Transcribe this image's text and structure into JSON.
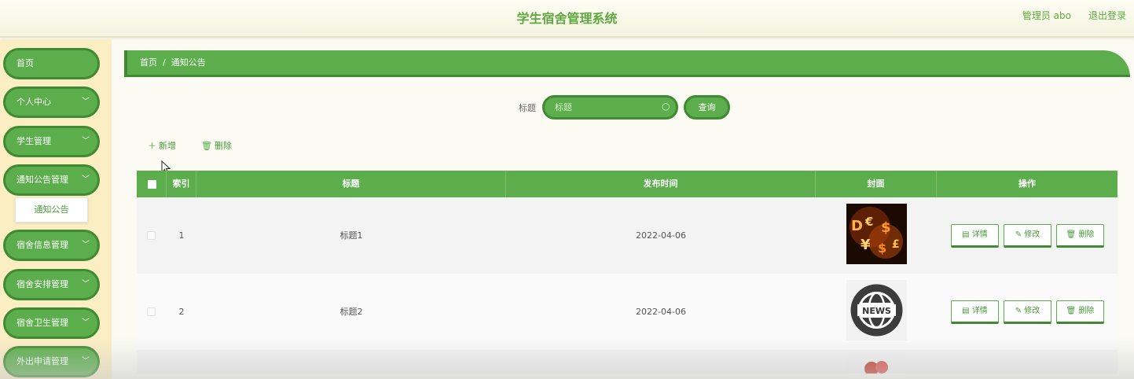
{
  "header": {
    "title": "学生宿舍管理系统",
    "user": "管理员 abo",
    "logout": "退出登录"
  },
  "sidebar": {
    "items": [
      {
        "label": "首页",
        "has_chevron": false
      },
      {
        "label": "个人中心",
        "has_chevron": true
      },
      {
        "label": "学生管理",
        "has_chevron": true
      },
      {
        "label": "通知公告管理",
        "has_chevron": true
      },
      {
        "label": "宿舍信息管理",
        "has_chevron": true
      },
      {
        "label": "宿舍安排管理",
        "has_chevron": true
      },
      {
        "label": "宿舍卫生管理",
        "has_chevron": true
      },
      {
        "label": "外出申请管理",
        "has_chevron": true
      }
    ],
    "submenu": {
      "label": "通知公告"
    }
  },
  "breadcrumb": {
    "home": "首页",
    "separator": "/",
    "current": "通知公告"
  },
  "search": {
    "label": "标题",
    "placeholder": "标题",
    "button": "查询"
  },
  "actions": {
    "add": "新增",
    "delete": "删除"
  },
  "table": {
    "columns": [
      "索引",
      "标题",
      "发布时间",
      "封面",
      "操作"
    ],
    "rows": [
      {
        "index": "1",
        "title": "标题1",
        "date": "2022-04-06",
        "cover": "money-symbols-image"
      },
      {
        "index": "2",
        "title": "标题2",
        "date": "2022-04-06",
        "cover": "news-globe-image"
      }
    ],
    "row_buttons": {
      "detail": "详情",
      "edit": "修改",
      "delete": "删除"
    }
  },
  "colors": {
    "primary": "#5cae4c",
    "primary_dark": "#3f8a32",
    "sidebar_bg": "#fbeec3",
    "title_green": "#5ea841"
  },
  "icons": [
    "plus-icon",
    "trash-icon",
    "search-icon",
    "chevron-down-icon",
    "document-icon",
    "edit-icon"
  ]
}
